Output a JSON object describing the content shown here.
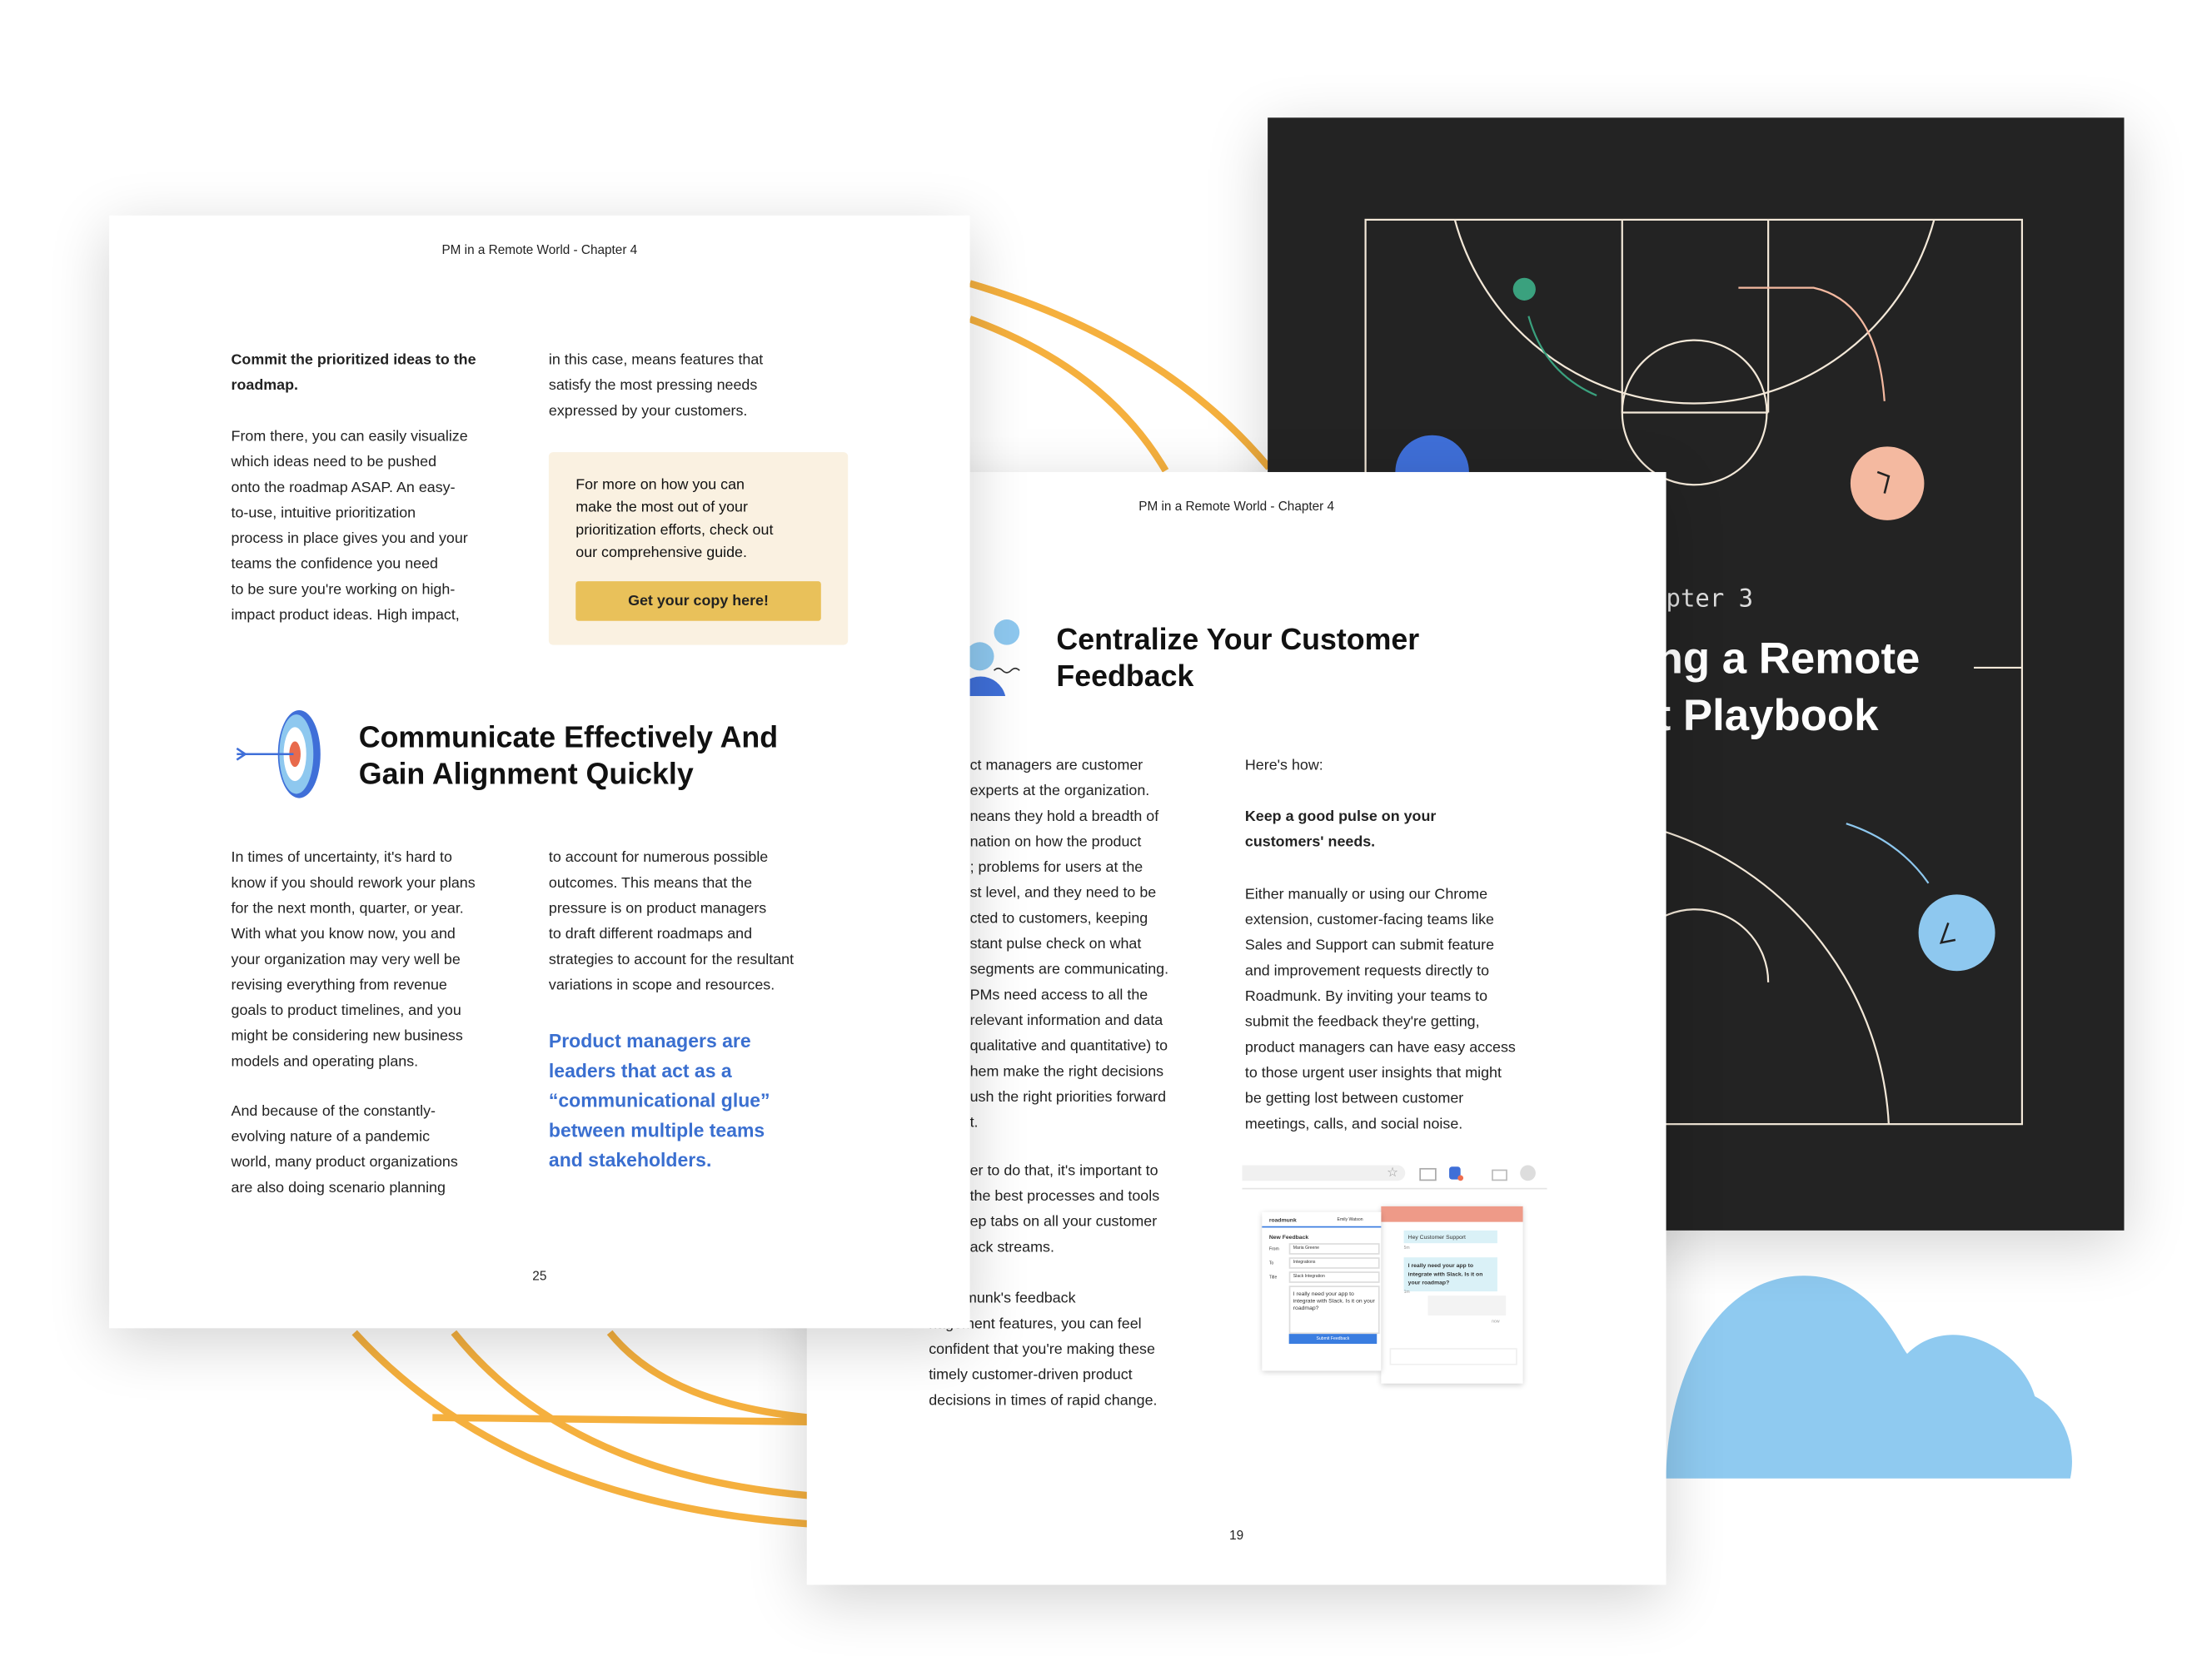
{
  "left_page": {
    "header": "PM in a Remote World - Chapter 4",
    "intro_heading": "Commit the prioritized ideas to the roadmap.",
    "intro_body": [
      "From there, you can easily visualize",
      "which ideas need to be pushed",
      "onto the roadmap ASAP. An easy-",
      "to-use, intuitive prioritization",
      "process in place gives you and your",
      "teams the confidence you need",
      "to be sure you're working on high-",
      "impact product ideas. High impact,"
    ],
    "col2_body": [
      "in this case, means features that",
      "satisfy the most pressing needs",
      "expressed by your customers."
    ],
    "callout_text": [
      "For more on how you can",
      "make the most out of your",
      "prioritization efforts, check out",
      "our comprehensive guide."
    ],
    "callout_button": "Get your copy here!",
    "section_title": [
      "Communicate Effectively And",
      "Gain Alignment Quickly"
    ],
    "section_col1": [
      "In times of uncertainty, it's hard to",
      "know if you should rework your plans",
      "for the next month, quarter, or year.",
      "With what you know  now, you and",
      "your organization may very well be",
      "revising everything from revenue",
      "goals to product timelines, and you",
      "might be considering new business",
      "models and operating plans."
    ],
    "section_col1_b": [
      "And because of the constantly-",
      "evolving nature of a pandemic",
      "world, many product organizations",
      "are also doing scenario planning"
    ],
    "section_col2": [
      "to account for numerous possible",
      "outcomes. This  means that the",
      "pressure is on product managers",
      "to draft different roadmaps and",
      "strategies to account for the resultant",
      "variations in scope and resources."
    ],
    "pull_quote": [
      "Product managers are",
      "leaders that act as a",
      "“communicational glue”",
      "between multiple teams",
      "and stakeholders."
    ],
    "page_number": "25"
  },
  "middle_page": {
    "header": "PM in a Remote World - Chapter 4",
    "title": [
      "Centralize Your Customer",
      "Feedback"
    ],
    "col1": [
      "ct managers are customer",
      "experts at the organization.",
      "neans they hold a breadth of",
      "nation on how the product",
      "; problems for users at the",
      "st level, and  they need to be",
      "cted to customers, keeping",
      "stant pulse check on what",
      "segments are communicating.",
      "PMs need access to all the",
      "relevant information and data",
      "qualitative and quantitative) to",
      "hem make the right decisions",
      "ush the right priorities forward",
      "t."
    ],
    "col1_b": [
      "er to do that, it's important to",
      "the best processes and tools",
      "ep tabs on all your  customer",
      "ack streams."
    ],
    "col1_c": [
      "Roadmunk's feedback",
      "nagement features, you can feel",
      "confident that you're making these",
      "timely customer-driven product",
      "decisions in times of rapid change."
    ],
    "col2_intro": "Here's how:",
    "col2_heading": [
      "Keep a good pulse on your",
      "customers' needs."
    ],
    "col2_body": [
      "Either manually or using our Chrome",
      "extension, customer-facing teams like",
      "Sales and Support can submit feature",
      "and improvement requests directly to",
      "Roadmunk. By inviting your teams to",
      "submit the feedback they're getting,",
      "product managers can have easy access",
      "to those urgent user insights that might",
      "be getting lost between customer",
      "meetings, calls, and social noise."
    ],
    "page_number": "19",
    "mockup": {
      "brand": "roadmunk",
      "user": "Emily Watson",
      "form_title": "New Feedback",
      "fields": [
        {
          "label": "From",
          "value": "Maria Greene"
        },
        {
          "label": "To",
          "value": "Integrations"
        },
        {
          "label": "Title",
          "value": "Slack Integration"
        }
      ],
      "message": "I really need your app to integrate with Slack. Is it on your roadmap?",
      "submit": "Submit Feedback",
      "chat_1": "Hey Customer Support",
      "chat_2": "I really need your app to integrate with Slack. Is it on your roadmap?",
      "time_1": "5m",
      "time_2": "1m",
      "time_3": "now"
    }
  },
  "cover_page": {
    "chapter": "pter 3",
    "title": [
      "ng a Remote",
      "t Playbook"
    ],
    "colors": {
      "background": "#232323",
      "lines": "#f3e8d8",
      "green": "#3aa17e",
      "peach": "#f4b9a0",
      "blue": "#8ec8ef",
      "royal": "#3f6fd8"
    }
  },
  "colors": {
    "globe": "#f5b03e",
    "cloud": "#8fcaf0",
    "accent_blue": "#3a6fd0",
    "button": "#e9c15a",
    "callout": "#faf1e1"
  }
}
